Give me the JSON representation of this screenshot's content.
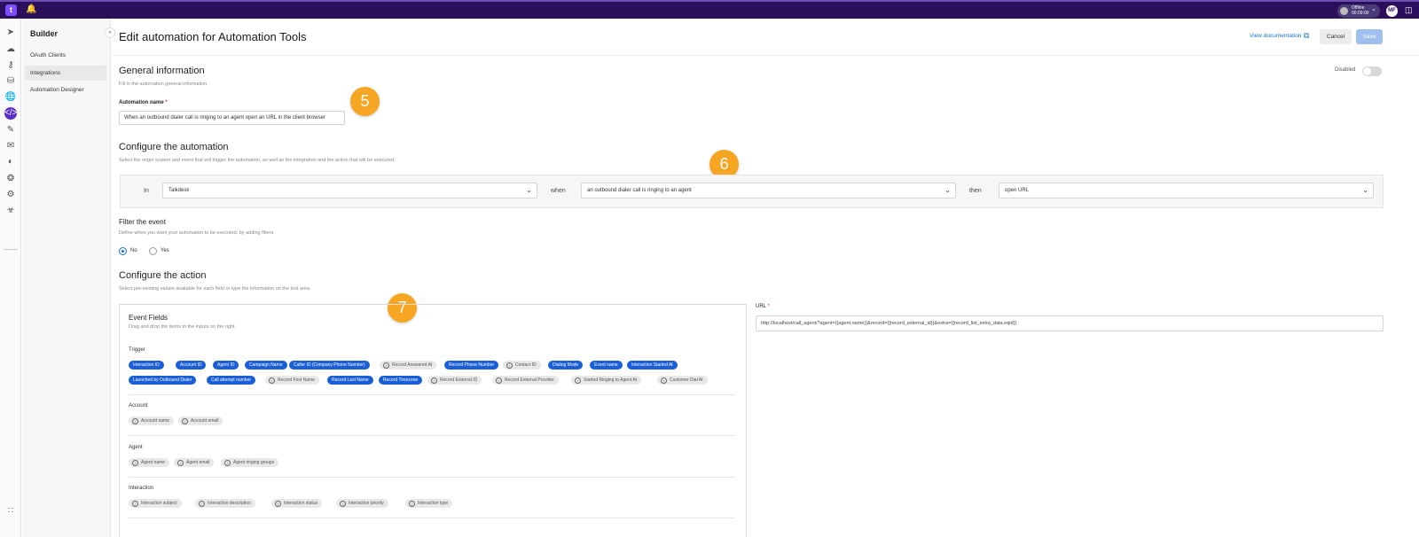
{
  "topbar": {
    "logo": "t",
    "status_line1": "Offline",
    "status_line2": "00:09:00",
    "avatar": "MF"
  },
  "sidebar": {
    "title": "Builder",
    "items": [
      {
        "label": "OAuth Clients",
        "active": false
      },
      {
        "label": "Integrations",
        "active": true
      },
      {
        "label": "Automation Designer",
        "active": false
      }
    ]
  },
  "header": {
    "title": "Edit automation for Automation Tools",
    "view_documentation": "View documentation",
    "cancel_label": "Cancel",
    "save_label": "Save"
  },
  "general": {
    "title": "General information",
    "subtitle": "Fill in the automation general information",
    "toggle_label": "Disabled",
    "toggle_on": false,
    "name_label": "Automation name",
    "name_required": "*",
    "name_value": "When an outbound dialer call is ringing to an agent open an URL in the client browser"
  },
  "badges": [
    "5",
    "6",
    "7"
  ],
  "configure": {
    "title": "Configure the automation",
    "subtitle": "Select the origin system and event that will trigger the automation, as well as the integration and the action that will be executed.",
    "in_label": "In",
    "in_value": "Talkdesk",
    "when_label": "when",
    "when_value": "an outbound dialer call is ringing to an agent",
    "then_label": "then",
    "then_value": "open URL"
  },
  "filter": {
    "title": "Filter the event",
    "subtitle": "Define when you want your automation to be executed, by adding filters.",
    "option_no": "No",
    "option_yes": "Yes",
    "selected": "No"
  },
  "action": {
    "title": "Configure the action",
    "subtitle": "Select pre-existing values available for each field or type the information on the text area.",
    "event_fields_title": "Event Fields",
    "event_fields_sub": "Drag and drop the items to the inputs on the right.",
    "groups": {
      "trigger": "Trigger",
      "account": "Account",
      "agent": "Agent",
      "interaction": "Interaction"
    },
    "trigger_row1": [
      {
        "label": "Interaction ID",
        "style": "blue"
      },
      {
        "label": "Account ID",
        "style": "blue"
      },
      {
        "label": "Agent ID",
        "style": "blue"
      },
      {
        "label": "Campaign Name",
        "style": "blue"
      },
      {
        "label": "Caller ID (Company Phone Number)",
        "style": "blue"
      },
      {
        "label": "Record Answered At",
        "style": "grey"
      },
      {
        "label": "Record Phone Number",
        "style": "blue"
      },
      {
        "label": "Contact ID",
        "style": "grey"
      },
      {
        "label": "Dialing Mode",
        "style": "blue"
      },
      {
        "label": "Event name",
        "style": "blue"
      },
      {
        "label": "Interaction Started At",
        "style": "blue"
      }
    ],
    "trigger_row2": [
      {
        "label": "Launched by Outbound Dialer",
        "style": "blue"
      },
      {
        "label": "Call attempt number",
        "style": "blue"
      },
      {
        "label": "Record First Name",
        "style": "grey"
      },
      {
        "label": "Record Last Name",
        "style": "blue"
      },
      {
        "label": "Record Timezone",
        "style": "blue"
      },
      {
        "label": "Record External ID",
        "style": "grey"
      },
      {
        "label": "Record External Provider",
        "style": "grey"
      },
      {
        "label": "Started Ringing to Agent At",
        "style": "grey"
      },
      {
        "label": "Customer Dial At",
        "style": "grey"
      }
    ],
    "account_chips": [
      "Account name",
      "Account email"
    ],
    "agent_chips": [
      "Agent name",
      "Agent email",
      "Agent ringing groups"
    ],
    "interaction_chips": [
      "Interaction subject",
      "Interaction description",
      "Interaction status",
      "Interaction priority",
      "Interaction type"
    ],
    "url_label": "URL",
    "url_required": "*",
    "url_value": "http://localhost/call_agent/?agent={{agent.name}}&record={{record_external_id}}&extra={{record_list_extra_data.eqid}}"
  },
  "colors": {
    "topbar": "#2b0f5c",
    "accent": "#5a2fc9",
    "chip_blue": "#1a5fd8",
    "badge": "#f6a623",
    "link": "#1a6fd8"
  }
}
